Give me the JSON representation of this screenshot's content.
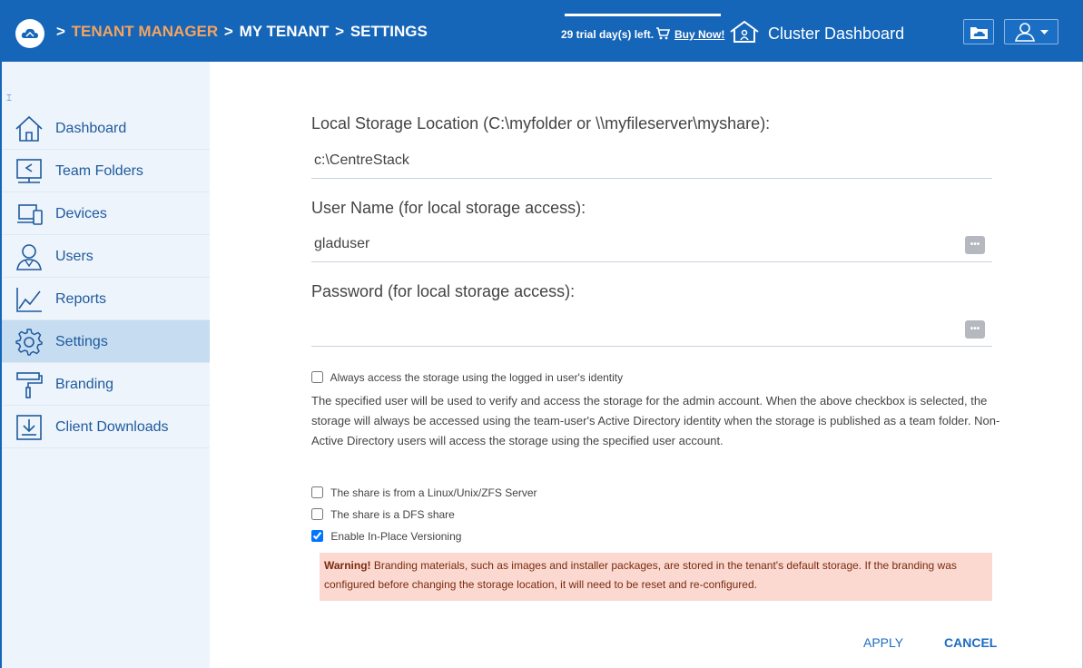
{
  "header": {
    "crumbs": {
      "sep1": ">",
      "tenant_manager": "TENANT MANAGER",
      "sep2": ">",
      "my_tenant": "MY TENANT",
      "sep3": ">",
      "settings": "SETTINGS"
    },
    "trial_text": "29 trial day(s) left.",
    "buy_now": "Buy Now!",
    "cluster_dashboard": "Cluster Dashboard",
    "accent_color": "#1565b8",
    "tenant_color": "#f4a460"
  },
  "sidebar": {
    "collapse": "⌶",
    "items": [
      {
        "label": "Dashboard",
        "icon": "home-icon"
      },
      {
        "label": "Team Folders",
        "icon": "team-folder-icon"
      },
      {
        "label": "Devices",
        "icon": "devices-icon"
      },
      {
        "label": "Users",
        "icon": "user-icon"
      },
      {
        "label": "Reports",
        "icon": "chart-icon"
      },
      {
        "label": "Settings",
        "icon": "gear-icon"
      },
      {
        "label": "Branding",
        "icon": "paint-roller-icon"
      },
      {
        "label": "Client Downloads",
        "icon": "download-icon"
      }
    ],
    "active_index": 5
  },
  "form": {
    "local_storage_label": "Local Storage Location (C:\\myfolder or \\\\myfileserver\\myshare):",
    "local_storage_value": "c:\\CentreStack",
    "username_label": "User Name (for local storage access):",
    "username_value": "gladuser",
    "password_label": "Password (for local storage access):",
    "password_value": "",
    "pw_button": "•••",
    "always_access_label": "Always access the storage using the logged in user's identity",
    "always_access_checked": false,
    "description": "The specified user will be used to verify and access the storage for the admin account. When the above checkbox is selected, the storage will always be accessed using the team-user's Active Directory identity when the storage is published as a team folder. Non-Active Directory users will access the storage using the specified user account.",
    "linux_label": "The share is from a Linux/Unix/ZFS Server",
    "linux_checked": false,
    "dfs_label": "The share is a DFS share",
    "dfs_checked": false,
    "versioning_label": "Enable In-Place Versioning",
    "versioning_checked": true,
    "warning_title": "Warning!",
    "warning_text": " Branding materials, such as images and installer packages, are stored in the tenant's default storage. If the branding was configured before changing the storage location, it will need to be reset and re-configured.",
    "apply": "APPLY",
    "cancel": "CANCEL"
  }
}
